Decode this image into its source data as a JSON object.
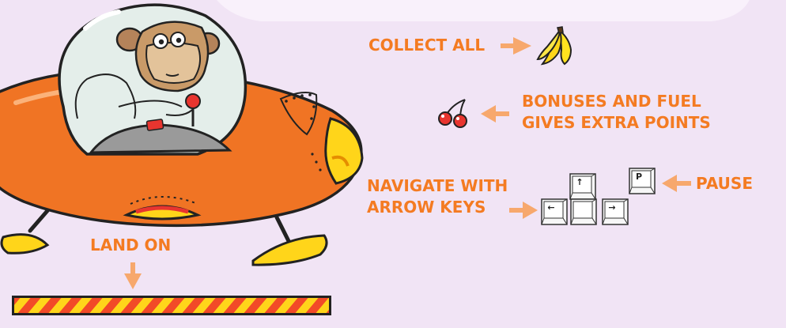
{
  "instructions": {
    "collect": "COLLECT ALL",
    "bonus_line1": "BONUSES AND FUEL",
    "bonus_line2": "GIVES EXTRA POINTS",
    "navigate_line1": "NAVIGATE WITH",
    "navigate_line2": "ARROW KEYS",
    "pause": "PAUSE",
    "land": "LAND ON"
  },
  "keys": {
    "up": "↑",
    "left": "←",
    "down": "",
    "right": "→",
    "pause": "P"
  },
  "icons": {
    "collect_item": "banana-icon",
    "bonus_item": "cherry-icon",
    "character": "monkey-in-ufo",
    "landing": "striped-landing-pad"
  },
  "colors": {
    "background": "#f1e4f5",
    "accent": "#f47b22",
    "arrow": "#f7a86d",
    "ufo": "#f07424",
    "yellow": "#ffd51a",
    "red": "#e8352f"
  }
}
